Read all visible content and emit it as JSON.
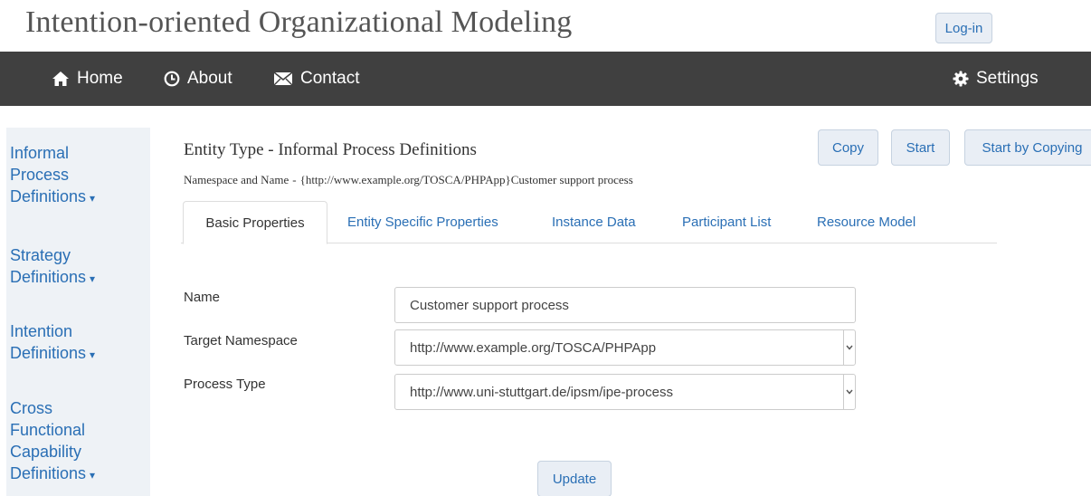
{
  "header": {
    "title": "Intention-oriented Organizational Modeling",
    "login_label": "Log-in"
  },
  "nav": {
    "home": "Home",
    "about": "About",
    "contact": "Contact",
    "settings": "Settings"
  },
  "sidebar": {
    "groups": [
      {
        "lines": [
          "Informal",
          "Process",
          "Definitions"
        ]
      },
      {
        "lines": [
          "Strategy",
          "Definitions"
        ]
      },
      {
        "lines": [
          "Intention",
          "Definitions"
        ]
      },
      {
        "lines": [
          "Cross",
          "Functional",
          "Capability",
          "Definitions"
        ]
      }
    ]
  },
  "entity": {
    "title": "Entity Type - Informal Process Definitions",
    "ns_label": "Namespace and Name",
    "ns_separator": "-",
    "ns_value": "{http://www.example.org/TOSCA/PHPApp}Customer support process"
  },
  "actions": {
    "copy": "Copy",
    "start": "Start",
    "start_copying": "Start by Copying"
  },
  "tabs": [
    {
      "label": "Basic Properties",
      "active": true
    },
    {
      "label": "Entity Specific Properties",
      "active": false
    },
    {
      "label": "Instance Data",
      "active": false
    },
    {
      "label": "Participant List",
      "active": false
    },
    {
      "label": "Resource Model",
      "active": false
    }
  ],
  "form": {
    "name_label": "Name",
    "name_value": "Customer support process",
    "namespace_label": "Target Namespace",
    "namespace_value": "http://www.example.org/TOSCA/PHPApp",
    "process_type_label": "Process Type",
    "process_type_value": "http://www.uni-stuttgart.de/ipsm/ipe-process",
    "update_label": "Update"
  },
  "colors": {
    "navbar_bg": "#404040",
    "link_blue": "#2a6fb5",
    "sidebar_bg": "#eef2f6",
    "button_bg": "#e9eef5"
  },
  "icons": {
    "home": "home-icon",
    "about": "clock-icon",
    "contact": "envelope-icon",
    "settings": "gear-icon",
    "dropdown": "chevron-down-icon"
  }
}
